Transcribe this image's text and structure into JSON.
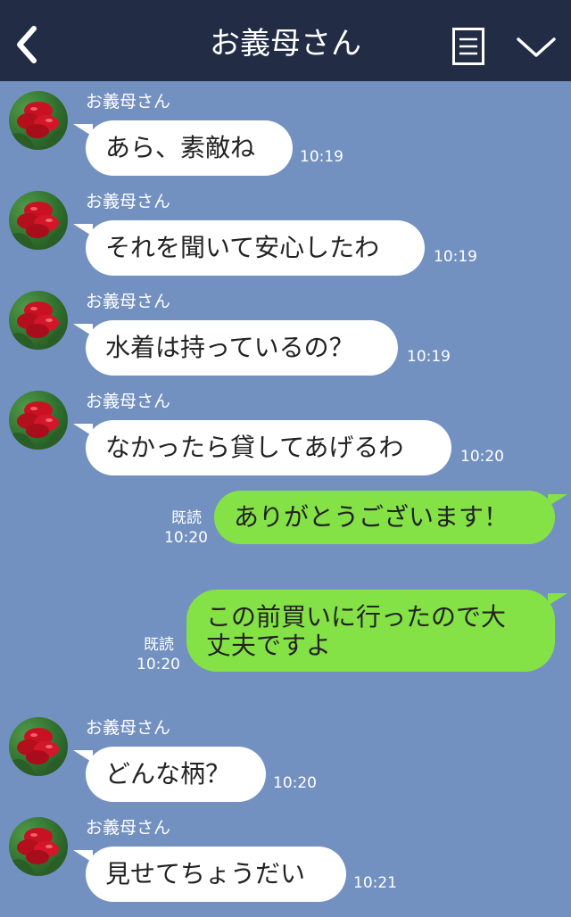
{
  "header": {
    "title": "お義母さん"
  },
  "colors": {
    "header_bg": "#222c44",
    "chat_bg": "#7391c0",
    "incoming_bubble": "#ffffff",
    "outgoing_bubble": "#84e246"
  },
  "icons": {
    "back": "chevron-left-icon",
    "menu": "menu-icon",
    "collapse": "chevron-down-icon"
  },
  "messages": [
    {
      "sender": "お義母さん",
      "text": "あら、素敵ね",
      "time": "10:19"
    },
    {
      "sender": "お義母さん",
      "text": "それを聞いて安心したわ",
      "time": "10:19"
    },
    {
      "sender": "お義母さん",
      "text": "水着は持っているの？",
      "time": "10:19"
    },
    {
      "sender": "お義母さん",
      "text": "なかったら貸してあげるわ",
      "time": "10:20"
    },
    {
      "read": "既読",
      "text": "ありがとうございます！",
      "time": "10:20"
    },
    {
      "read": "既読",
      "text": "この前買いに行ったので大丈夫ですよ",
      "line1": "この前買いに行ったので大",
      "line2": "丈夫ですよ",
      "time": "10:20"
    },
    {
      "sender": "お義母さん",
      "text": "どんな柄？",
      "time": "10:20"
    },
    {
      "sender": "お義母さん",
      "text": "見せてちょうだい",
      "time": "10:21"
    }
  ]
}
